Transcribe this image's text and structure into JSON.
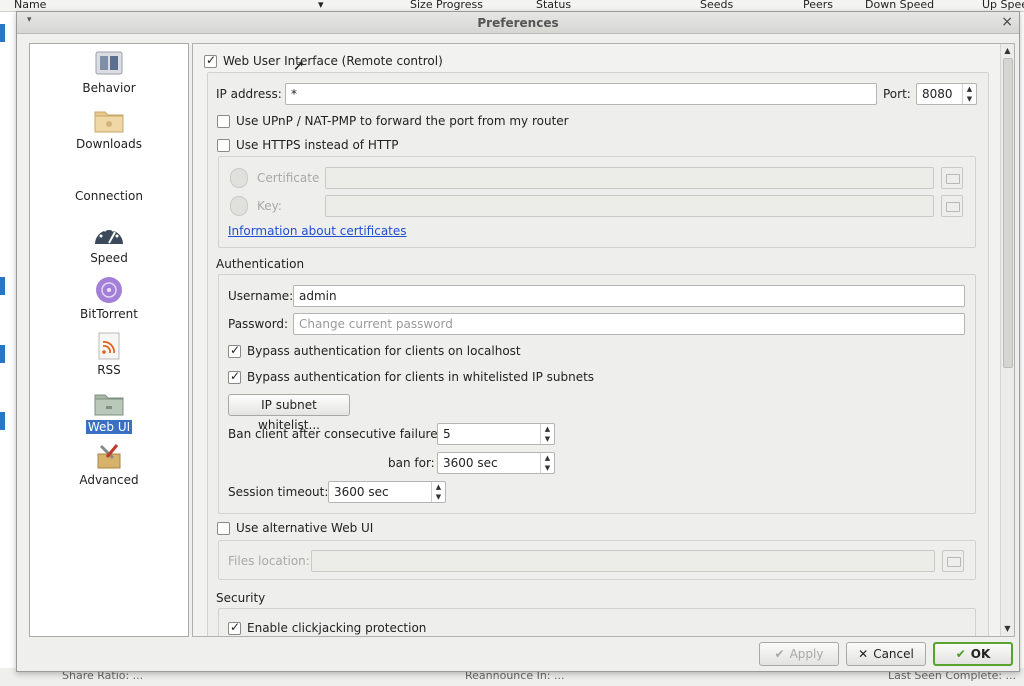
{
  "background": {
    "columns": [
      "Name",
      "Size",
      "Progress",
      "Status",
      "Seeds",
      "Peers",
      "Down Speed",
      "Up Speed"
    ],
    "footer": [
      "Share Ratio: ...",
      "Reannounce In: ...",
      "Last Seen Complete: ..."
    ]
  },
  "dialog": {
    "title": "Preferences",
    "close_glyph": "×",
    "menu_glyph": "▾"
  },
  "sidebar": {
    "items": [
      {
        "label": "Behavior",
        "icon": "behavior-icon"
      },
      {
        "label": "Downloads",
        "icon": "folder-icon"
      },
      {
        "label": "Connection",
        "icon": "connection-icon"
      },
      {
        "label": "Speed",
        "icon": "speedometer-icon"
      },
      {
        "label": "BitTorrent",
        "icon": "bittorrent-icon"
      },
      {
        "label": "RSS",
        "icon": "rss-icon"
      },
      {
        "label": "Web UI",
        "icon": "webui-folder-icon"
      },
      {
        "label": "Advanced",
        "icon": "advanced-tools-icon"
      }
    ],
    "selected": "Web UI"
  },
  "webui": {
    "enable_label": "Web User Interface (Remote control)",
    "enable_checked": true,
    "ip_label": "IP address:",
    "ip_value": "*",
    "port_label": "Port:",
    "port_value": "8080",
    "upnp_label": "Use UPnP / NAT-PMP to forward the port from my router",
    "upnp_checked": false,
    "https_label": "Use HTTPS instead of HTTP",
    "https_checked": false,
    "certificate_label": "Certificate",
    "key_label": "Key:",
    "cert_link": "Information about certificates",
    "auth_title": "Authentication",
    "username_label": "Username:",
    "username_value": "admin",
    "password_label": "Password:",
    "password_placeholder": "Change current password",
    "bypass_localhost_label": "Bypass authentication for clients on localhost",
    "bypass_localhost_checked": true,
    "bypass_whitelist_label": "Bypass authentication for clients in whitelisted IP subnets",
    "bypass_whitelist_checked": true,
    "whitelist_button": "IP subnet whitelist...",
    "ban_label": "Ban client after consecutive failures:",
    "ban_value": "5",
    "banfor_label": "ban for:",
    "banfor_value": "3600 sec",
    "session_label": "Session timeout:",
    "session_value": "3600 sec",
    "alt_webui_label": "Use alternative Web UI",
    "alt_webui_checked": false,
    "files_location_label": "Files location:",
    "security_title": "Security",
    "clickjacking_label": "Enable clickjacking protection",
    "clickjacking_checked": true
  },
  "footer": {
    "apply": "Apply",
    "cancel": "Cancel",
    "ok": "OK"
  },
  "colors": {
    "selection": "#3a6fc4",
    "link": "#1f4fd1",
    "ok_border": "#5aa22e"
  }
}
